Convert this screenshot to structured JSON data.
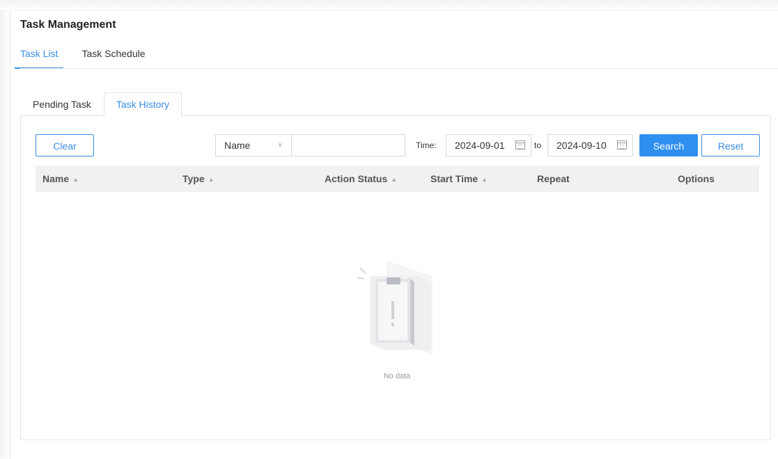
{
  "page": {
    "title": "Task Management"
  },
  "top_tabs": [
    {
      "label": "Task List",
      "active": true
    },
    {
      "label": "Task Schedule",
      "active": false
    }
  ],
  "sub_tabs": [
    {
      "label": "Pending Task",
      "active": false
    },
    {
      "label": "Task History",
      "active": true
    }
  ],
  "toolbar": {
    "clear_label": "Clear",
    "filter_field": "Name",
    "search_value": "",
    "time_label": "Time:",
    "start_date": "2024-09-01",
    "to_label": "to",
    "end_date": "2024-09-10",
    "search_label": "Search",
    "reset_label": "Reset"
  },
  "table": {
    "columns": [
      {
        "label": "Name",
        "sortable": true
      },
      {
        "label": "Type",
        "sortable": true
      },
      {
        "label": "Action Status",
        "sortable": true
      },
      {
        "label": "Start Time",
        "sortable": true
      },
      {
        "label": "Repeat",
        "sortable": false
      },
      {
        "label": "Options",
        "sortable": false
      }
    ],
    "rows": [],
    "empty_text": "No data"
  },
  "colors": {
    "accent": "#2f8ff0",
    "active_tab": "#3a8ee6",
    "header_bg": "#f0f1f3"
  }
}
